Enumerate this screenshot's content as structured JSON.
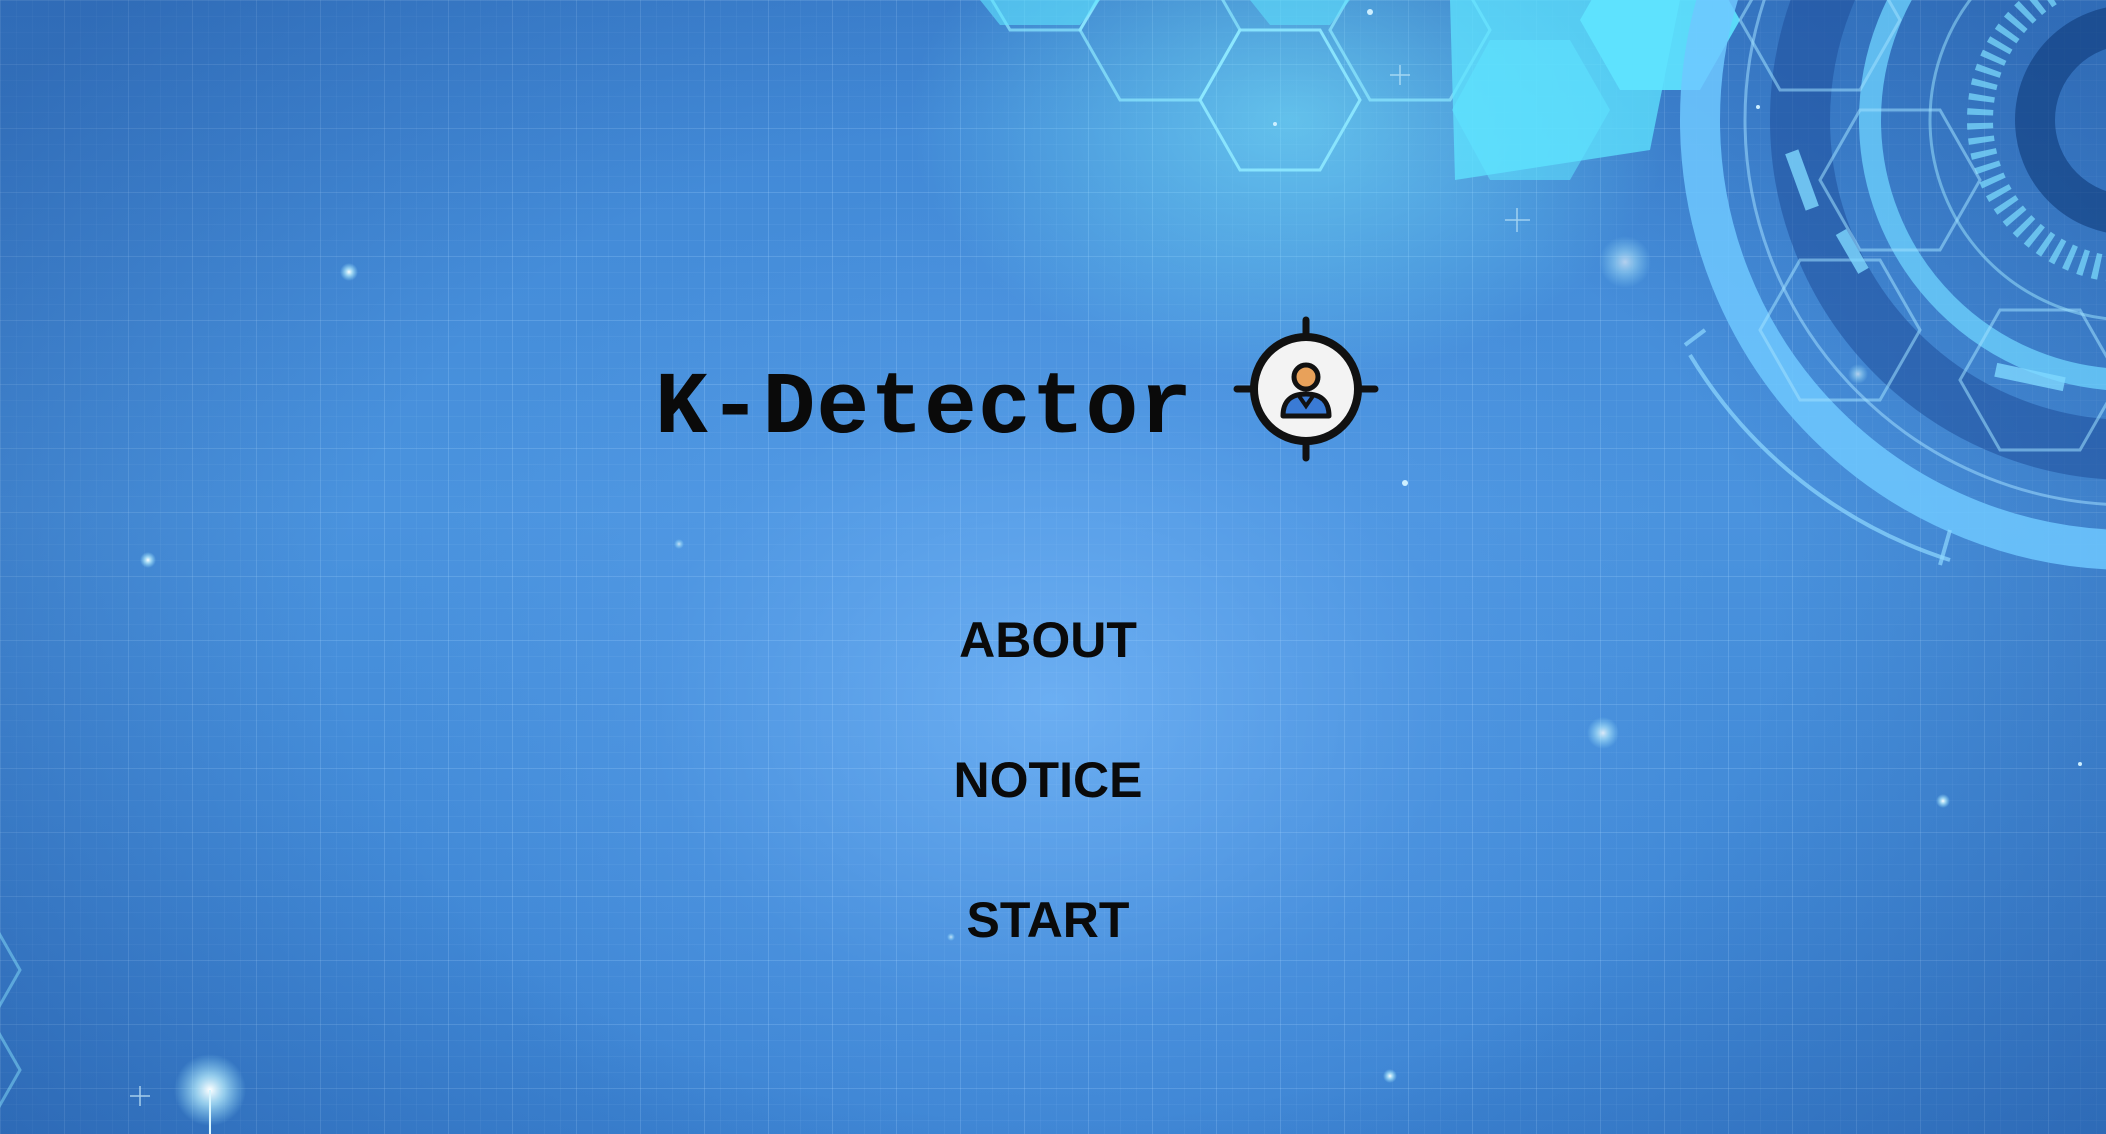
{
  "app": {
    "title": "K-Detector",
    "logo_icon": "crosshair-person-icon"
  },
  "menu": {
    "items": [
      {
        "label": "ABOUT"
      },
      {
        "label": "NOTICE"
      },
      {
        "label": "START"
      }
    ]
  },
  "theme": {
    "background": "#4a93de",
    "accent": "#6fe3ff",
    "text": "#0a0a0a",
    "logo_face": "#e8a15a",
    "logo_body": "#3a7bd5"
  }
}
